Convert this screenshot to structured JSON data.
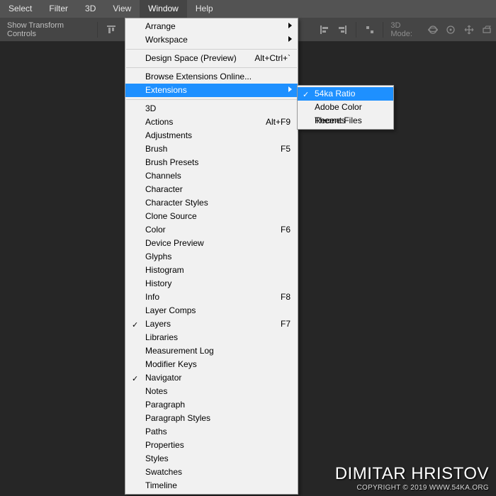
{
  "menubar": {
    "items": [
      "Select",
      "Filter",
      "3D",
      "View",
      "Window",
      "Help"
    ],
    "active_index": 4
  },
  "toolbar": {
    "transform_controls": "Show Transform Controls",
    "mode_label": "3D Mode:"
  },
  "window_menu": {
    "groups": [
      [
        {
          "label": "Arrange",
          "submenu": true
        },
        {
          "label": "Workspace",
          "submenu": true
        }
      ],
      [
        {
          "label": "Design Space (Preview)",
          "shortcut": "Alt+Ctrl+`"
        }
      ],
      [
        {
          "label": "Browse Extensions Online..."
        },
        {
          "label": "Extensions",
          "submenu": true,
          "selected": true
        }
      ],
      [
        {
          "label": "3D"
        },
        {
          "label": "Actions",
          "shortcut": "Alt+F9"
        },
        {
          "label": "Adjustments"
        },
        {
          "label": "Brush",
          "shortcut": "F5"
        },
        {
          "label": "Brush Presets"
        },
        {
          "label": "Channels"
        },
        {
          "label": "Character"
        },
        {
          "label": "Character Styles"
        },
        {
          "label": "Clone Source"
        },
        {
          "label": "Color",
          "shortcut": "F6"
        },
        {
          "label": "Device Preview"
        },
        {
          "label": "Glyphs"
        },
        {
          "label": "Histogram"
        },
        {
          "label": "History"
        },
        {
          "label": "Info",
          "shortcut": "F8"
        },
        {
          "label": "Layer Comps"
        },
        {
          "label": "Layers",
          "shortcut": "F7",
          "checked": true
        },
        {
          "label": "Libraries"
        },
        {
          "label": "Measurement Log"
        },
        {
          "label": "Modifier Keys"
        },
        {
          "label": "Navigator",
          "checked": true
        },
        {
          "label": "Notes"
        },
        {
          "label": "Paragraph"
        },
        {
          "label": "Paragraph Styles"
        },
        {
          "label": "Paths"
        },
        {
          "label": "Properties"
        },
        {
          "label": "Styles"
        },
        {
          "label": "Swatches"
        },
        {
          "label": "Timeline"
        }
      ]
    ]
  },
  "extensions_submenu": [
    {
      "label": "54ka Ratio",
      "checked": true,
      "selected": true
    },
    {
      "label": "Adobe Color Themes"
    },
    {
      "label": "Recent Files"
    }
  ],
  "watermark": {
    "name": "DIMITAR HRISTOV",
    "sub": "COPYRIGHT © 2019 WWW.54KA.ORG"
  }
}
